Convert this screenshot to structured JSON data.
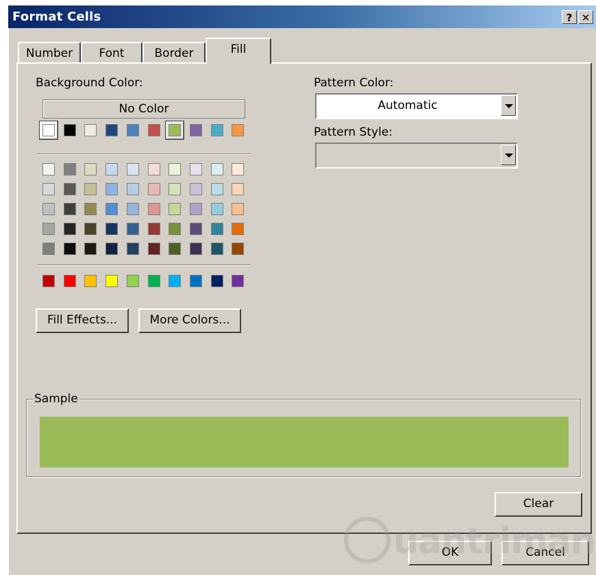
{
  "window": {
    "title": "Format Cells",
    "help_label": "?",
    "close_label": "✕"
  },
  "tabs": [
    {
      "label": "Number",
      "active": false
    },
    {
      "label": "Font",
      "active": false
    },
    {
      "label": "Border",
      "active": false
    },
    {
      "label": "Fill",
      "active": true
    }
  ],
  "fill": {
    "background_color_label": "Background Color:",
    "no_color_label": "No Color",
    "theme_row": [
      "#ffffff",
      "#000000",
      "#eeece1",
      "#1f497d",
      "#4f81bd",
      "#c0504d",
      "#9bbb59",
      "#8064a2",
      "#4bacc6",
      "#f79646"
    ],
    "selected_index": 6,
    "tints": [
      [
        "#f2f2f2",
        "#7f7f7f",
        "#ddd9c3",
        "#c6d9f0",
        "#dbe5f1",
        "#f2dcdb",
        "#ebf1dd",
        "#e5e0ec",
        "#dbeef3",
        "#fdeada"
      ],
      [
        "#d8d8d8",
        "#595959",
        "#c4bd97",
        "#8db3e2",
        "#b8cce4",
        "#e5b9b7",
        "#d7e3bc",
        "#ccc1d9",
        "#b7dde8",
        "#fbd5b5"
      ],
      [
        "#bfbfbf",
        "#3f3f3f",
        "#938953",
        "#548dd4",
        "#95b3d7",
        "#d99694",
        "#c3d69b",
        "#b2a2c7",
        "#92cddc",
        "#fac08f"
      ],
      [
        "#a5a5a5",
        "#262626",
        "#494429",
        "#17365d",
        "#366092",
        "#953734",
        "#76923c",
        "#5f497a",
        "#31859b",
        "#e36c09"
      ],
      [
        "#7f7f7f",
        "#0c0c0c",
        "#1d1b10",
        "#0f243e",
        "#244061",
        "#632423",
        "#4f6128",
        "#3f3151",
        "#205867",
        "#974806"
      ]
    ],
    "standard": [
      "#c00000",
      "#ff0000",
      "#ffc000",
      "#ffff00",
      "#92d050",
      "#00b050",
      "#00b0f0",
      "#0070c0",
      "#002060",
      "#7030a0"
    ],
    "fill_effects_label": "Fill Effects...",
    "more_colors_label": "More Colors...",
    "pattern_color_label": "Pattern Color:",
    "pattern_color_value": "Automatic",
    "pattern_style_label": "Pattern Style:",
    "pattern_style_value": "",
    "sample_label": "Sample",
    "sample_color": "#9bbb59",
    "clear_label": "Clear"
  },
  "footer": {
    "ok_label": "OK",
    "cancel_label": "Cancel"
  },
  "watermark": {
    "text": "uantrimang"
  }
}
